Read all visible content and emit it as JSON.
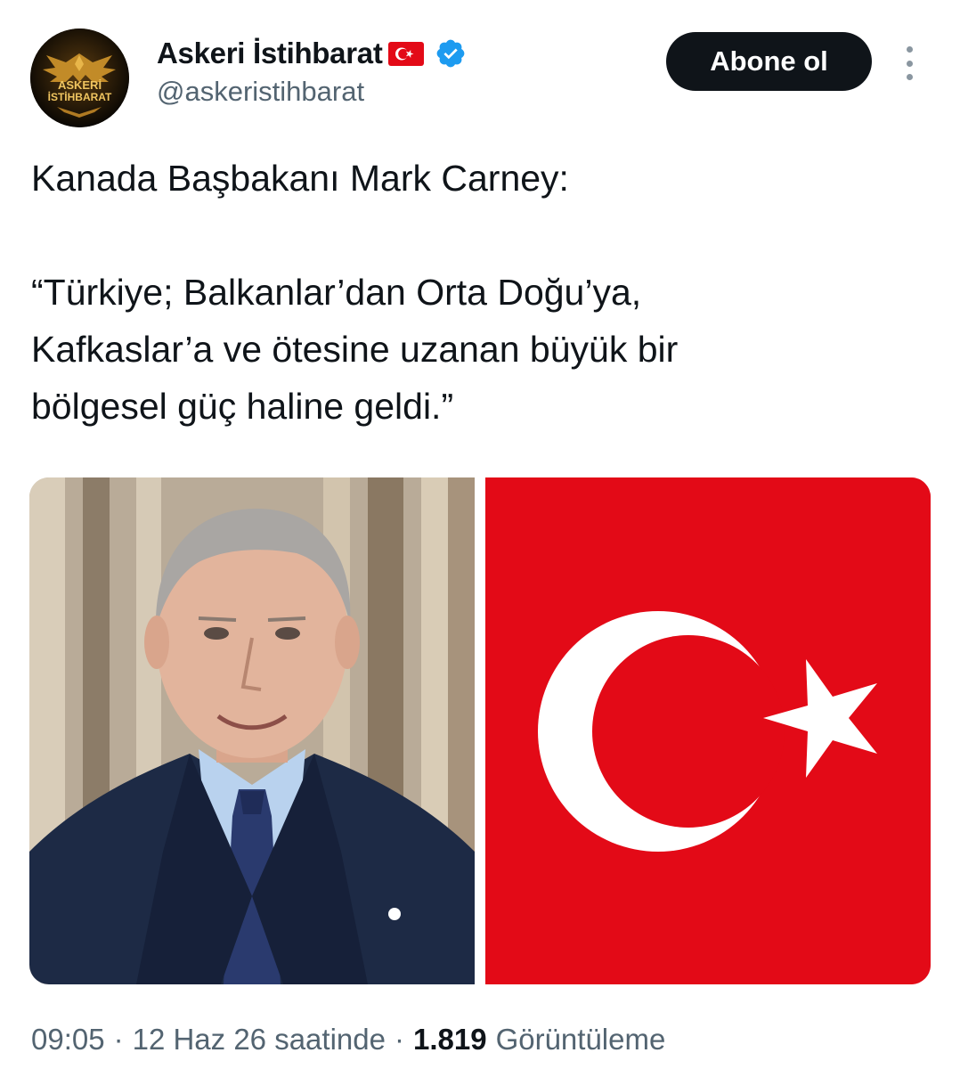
{
  "author": {
    "display_name": "Askeri İstihbarat",
    "handle": "@askeristihbarat",
    "avatar_text_line1": "ASKERİ",
    "avatar_text_line2": "İSTİHBARAT",
    "verified": true,
    "flag_icon": "turkey-flag-emoji-icon"
  },
  "actions": {
    "follow_label": "Abone ol"
  },
  "tweet": {
    "lines": [
      "Kanada Başbakanı Mark Carney:",
      "",
      "“Türkiye; Balkanlar’dan Orta Doğu’ya,",
      "Kafkaslar’a ve ötesine uzanan büyük bir",
      "bölgesel güç haline geldi.”"
    ]
  },
  "media": {
    "left_image": "portrait-photo",
    "right_image": "turkish-flag"
  },
  "meta": {
    "time": "09:05",
    "date": "12 Haz 26 saatinde",
    "views_count": "1.819",
    "views_label": "Görüntüleme",
    "separator": "·"
  },
  "colors": {
    "text_primary": "#0f1419",
    "text_secondary": "#536471",
    "verified_blue": "#1d9bf0",
    "flag_red": "#e30a17",
    "button_bg": "#0f1419"
  }
}
